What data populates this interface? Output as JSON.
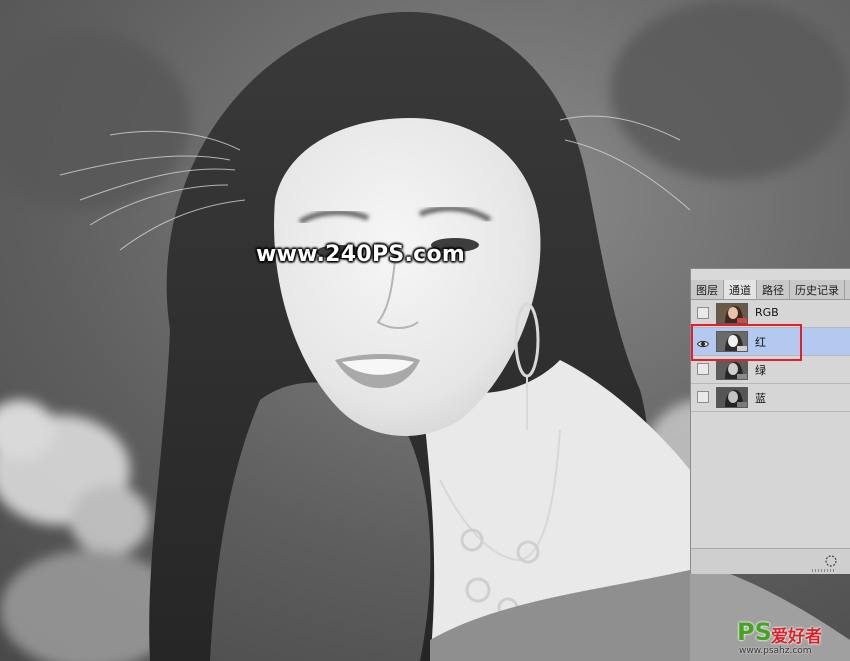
{
  "watermark": "www.240PS.com",
  "channels_panel": {
    "tabs": [
      {
        "label": "图层",
        "active": false
      },
      {
        "label": "通道",
        "active": true
      },
      {
        "label": "路径",
        "active": false
      },
      {
        "label": "历史记录",
        "active": false
      }
    ],
    "channels": [
      {
        "label": "RGB",
        "visible": false,
        "selected": false
      },
      {
        "label": "红",
        "visible": true,
        "selected": true
      },
      {
        "label": "绿",
        "visible": false,
        "selected": false
      },
      {
        "label": "蓝",
        "visible": false,
        "selected": false
      }
    ],
    "selection_color": "#b4c9f0"
  },
  "annotation": {
    "highlight_color": "#e0202f"
  },
  "logo": {
    "ps": "PS",
    "name": "爱好者",
    "url": "www.psahz.com"
  },
  "icons": [
    "eye-icon",
    "load-channel-as-selection-icon",
    "resize-grip-icon"
  ]
}
